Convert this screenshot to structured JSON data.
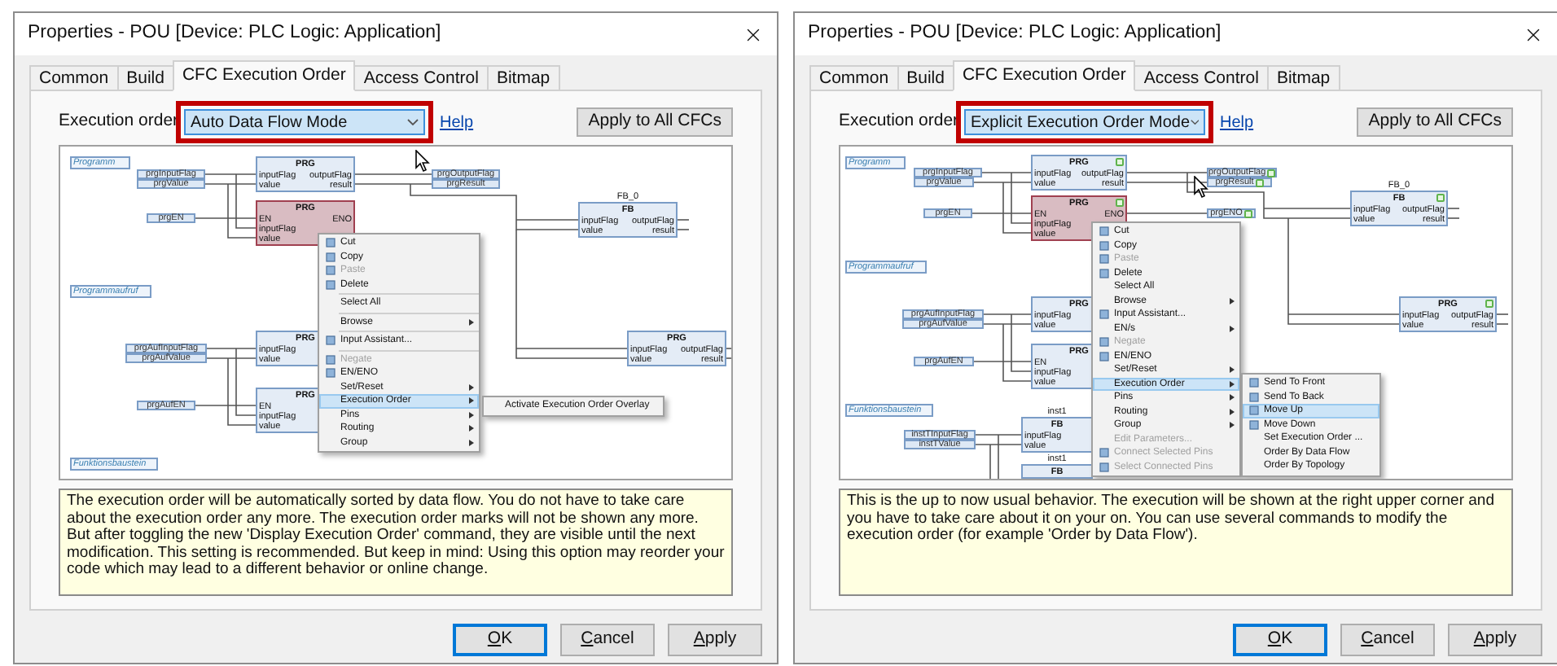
{
  "dialogs": [
    {
      "title": "Properties - POU [Device: PLC Logic: Application]",
      "tabs": [
        {
          "label": "Common",
          "selected": false
        },
        {
          "label": "Build",
          "selected": false
        },
        {
          "label": "CFC Execution Order",
          "selected": true
        },
        {
          "label": "Access Control",
          "selected": false
        },
        {
          "label": "Bitmap",
          "selected": false
        }
      ],
      "execution_order": {
        "label": "Execution order",
        "value": "Auto Data Flow Mode"
      },
      "help_link": "Help",
      "apply_all_button": "Apply to All CFCs",
      "diagram": {
        "comments": [
          "Programm",
          "Programmaufruf",
          "Funktionsbaustein"
        ],
        "variables": [
          {
            "name": "prgInputFlag",
            "order_badge": false
          },
          {
            "name": "prgOutputFlag",
            "order_badge": false
          },
          {
            "name": "prgValue",
            "order_badge": false
          },
          {
            "name": "prgResult",
            "order_badge": false
          },
          {
            "name": "prgEN",
            "order_badge": false
          },
          {
            "name": "prgAufInputFlag",
            "order_badge": false
          },
          {
            "name": "prgAufValue",
            "order_badge": false
          },
          {
            "name": "prgAufEN",
            "order_badge": false
          }
        ],
        "blocks": [
          {
            "type": "PRG",
            "inputs": [
              "inputFlag",
              "value"
            ],
            "outputs": [
              "outputFlag",
              "result"
            ],
            "selected": false,
            "order_badge": false
          },
          {
            "type": "PRG",
            "inputs": [
              "EN",
              "inputFlag",
              "value"
            ],
            "outputs": [
              "ENO"
            ],
            "selected": true,
            "order_badge": false
          },
          {
            "type": "FB",
            "instance": "FB_0",
            "inputs": [
              "inputFlag",
              "value"
            ],
            "outputs": [
              "outputFlag",
              "result"
            ],
            "selected": false,
            "order_badge": false
          },
          {
            "type": "PRG",
            "inputs": [
              "inputFlag",
              "value"
            ],
            "selected": false
          },
          {
            "type": "PRG",
            "inputs": [
              "inputFlag",
              "value"
            ],
            "outputs": [
              "outputFlag",
              "result"
            ],
            "selected": false,
            "order_badge": false
          },
          {
            "type": "PRG",
            "inputs": [
              "EN",
              "inputFlag",
              "value"
            ],
            "selected": false
          }
        ],
        "context_menu": [
          {
            "kind": "item",
            "label": "Cut",
            "has_icon": true,
            "disabled": false,
            "highlighted": false,
            "has_submenu": false
          },
          {
            "kind": "item",
            "label": "Copy",
            "has_icon": true,
            "disabled": false,
            "highlighted": false,
            "has_submenu": false
          },
          {
            "kind": "item",
            "label": "Paste",
            "has_icon": true,
            "disabled": true,
            "highlighted": false,
            "has_submenu": false
          },
          {
            "kind": "item",
            "label": "Delete",
            "has_icon": true,
            "disabled": false,
            "highlighted": false,
            "has_submenu": false
          },
          {
            "kind": "separator"
          },
          {
            "kind": "item",
            "label": "Select All",
            "has_icon": false,
            "disabled": false,
            "highlighted": false,
            "has_submenu": false
          },
          {
            "kind": "separator"
          },
          {
            "kind": "item",
            "label": "Browse",
            "has_icon": false,
            "disabled": false,
            "highlighted": false,
            "has_submenu": true
          },
          {
            "kind": "separator"
          },
          {
            "kind": "item",
            "label": "Input Assistant...",
            "has_icon": true,
            "disabled": false,
            "highlighted": false,
            "has_submenu": false
          },
          {
            "kind": "separator"
          },
          {
            "kind": "item",
            "label": "Negate",
            "has_icon": true,
            "disabled": true,
            "highlighted": false,
            "has_submenu": false
          },
          {
            "kind": "item",
            "label": "EN/ENO",
            "has_icon": true,
            "disabled": false,
            "highlighted": false,
            "has_submenu": false
          },
          {
            "kind": "item",
            "label": "Set/Reset",
            "has_icon": false,
            "disabled": false,
            "highlighted": false,
            "has_submenu": true
          },
          {
            "kind": "item",
            "label": "Execution Order",
            "has_icon": false,
            "disabled": false,
            "highlighted": true,
            "has_submenu": true
          },
          {
            "kind": "item",
            "label": "Pins",
            "has_icon": false,
            "disabled": false,
            "highlighted": false,
            "has_submenu": true
          },
          {
            "kind": "item",
            "label": "Routing",
            "has_icon": false,
            "disabled": false,
            "highlighted": false,
            "has_submenu": true
          },
          {
            "kind": "item",
            "label": "Group",
            "has_icon": false,
            "disabled": false,
            "highlighted": false,
            "has_submenu": true
          }
        ],
        "submenu": [
          {
            "label": "Activate Execution Order Overlay",
            "has_icon": false,
            "highlighted": false
          }
        ]
      },
      "description": "The execution order will be automatically sorted by data flow. You do not have to take care about the execution order any more. The execution order marks will not be shown any more. But after toggling the new 'Display Execution Order' command, they are visible until the next modification. This setting is recommended. But keep in mind: Using this option may reorder your code which may lead to a different behavior or online change.",
      "buttons": [
        {
          "label": "OK",
          "default": true
        },
        {
          "label": "Cancel",
          "default": false
        },
        {
          "label": "Apply",
          "default": false
        }
      ]
    },
    {
      "title": "Properties - POU [Device: PLC Logic: Application]",
      "tabs": [
        {
          "label": "Common",
          "selected": false
        },
        {
          "label": "Build",
          "selected": false
        },
        {
          "label": "CFC Execution Order",
          "selected": true
        },
        {
          "label": "Access Control",
          "selected": false
        },
        {
          "label": "Bitmap",
          "selected": false
        }
      ],
      "execution_order": {
        "label": "Execution order",
        "value": "Explicit Execution Order Mode"
      },
      "help_link": "Help",
      "apply_all_button": "Apply to All CFCs",
      "diagram": {
        "comments": [
          "Programm",
          "Programmaufruf",
          "Funktionsbaustein"
        ],
        "variables": [
          {
            "name": "prgInputFlag",
            "order_badge": false
          },
          {
            "name": "prgOutputFlag",
            "order_badge": true
          },
          {
            "name": "prgValue",
            "order_badge": false
          },
          {
            "name": "prgResult",
            "order_badge": true
          },
          {
            "name": "prgEN",
            "order_badge": false
          },
          {
            "name": "prgENO",
            "order_badge": true
          },
          {
            "name": "prgAufInputFlag",
            "order_badge": false
          },
          {
            "name": "prgAufValue",
            "order_badge": false
          },
          {
            "name": "prgAufEN",
            "order_badge": false
          },
          {
            "name": "instTInputFlag",
            "order_badge": false
          },
          {
            "name": "instTValue",
            "order_badge": false
          }
        ],
        "blocks": [
          {
            "type": "PRG",
            "inputs": [
              "inputFlag",
              "value"
            ],
            "outputs": [
              "outputFlag",
              "result"
            ],
            "selected": false,
            "order_badge": true
          },
          {
            "type": "PRG",
            "inputs": [
              "EN",
              "inputFlag",
              "value"
            ],
            "outputs": [
              "ENO"
            ],
            "selected": true,
            "order_badge": true
          },
          {
            "type": "FB",
            "instance": "FB_0",
            "inputs": [
              "inputFlag",
              "value"
            ],
            "outputs": [
              "outputFlag",
              "result"
            ],
            "selected": false,
            "order_badge": true
          },
          {
            "type": "PRG",
            "inputs": [
              "inputFlag",
              "value"
            ],
            "selected": false
          },
          {
            "type": "PRG",
            "inputs": [
              "inputFlag",
              "value"
            ],
            "outputs": [
              "outputFlag",
              "result"
            ],
            "selected": false,
            "order_badge": true
          },
          {
            "type": "PRG",
            "inputs": [
              "EN",
              "inputFlag",
              "value"
            ],
            "selected": false
          },
          {
            "type": "FB",
            "instance": "inst1",
            "inputs": [
              "inputFlag",
              "value"
            ],
            "selected": false,
            "order_badge": false
          },
          {
            "type": "FB",
            "instance": "inst1",
            "selected": false,
            "order_badge": false
          }
        ],
        "context_menu": [
          {
            "kind": "item",
            "label": "Cut",
            "has_icon": true,
            "disabled": false,
            "highlighted": false,
            "has_submenu": false
          },
          {
            "kind": "item",
            "label": "Copy",
            "has_icon": true,
            "disabled": false,
            "highlighted": false,
            "has_submenu": false
          },
          {
            "kind": "item",
            "label": "Paste",
            "has_icon": true,
            "disabled": true,
            "highlighted": false,
            "has_submenu": false
          },
          {
            "kind": "item",
            "label": "Delete",
            "has_icon": true,
            "disabled": false,
            "highlighted": false,
            "has_submenu": false
          },
          {
            "kind": "item",
            "label": "Select All",
            "has_icon": false,
            "disabled": false,
            "highlighted": false,
            "has_submenu": false
          },
          {
            "kind": "item",
            "label": "Browse",
            "has_icon": false,
            "disabled": false,
            "highlighted": false,
            "has_submenu": true
          },
          {
            "kind": "item",
            "label": "Input Assistant...",
            "has_icon": true,
            "disabled": false,
            "highlighted": false,
            "has_submenu": false
          },
          {
            "kind": "item",
            "label": "EN/s",
            "has_icon": false,
            "disabled": false,
            "highlighted": false,
            "has_submenu": true
          },
          {
            "kind": "item",
            "label": "Negate",
            "has_icon": true,
            "disabled": true,
            "highlighted": false,
            "has_submenu": false
          },
          {
            "kind": "item",
            "label": "EN/ENO",
            "has_icon": true,
            "disabled": false,
            "highlighted": false,
            "has_submenu": false
          },
          {
            "kind": "item",
            "label": "Set/Reset",
            "has_icon": false,
            "disabled": false,
            "highlighted": false,
            "has_submenu": true
          },
          {
            "kind": "item",
            "label": "Execution Order",
            "has_icon": false,
            "disabled": false,
            "highlighted": true,
            "has_submenu": true
          },
          {
            "kind": "item",
            "label": "Pins",
            "has_icon": false,
            "disabled": false,
            "highlighted": false,
            "has_submenu": true
          },
          {
            "kind": "item",
            "label": "Routing",
            "has_icon": false,
            "disabled": false,
            "highlighted": false,
            "has_submenu": true
          },
          {
            "kind": "item",
            "label": "Group",
            "has_icon": false,
            "disabled": false,
            "highlighted": false,
            "has_submenu": true
          },
          {
            "kind": "item",
            "label": "Edit Parameters...",
            "has_icon": false,
            "disabled": true,
            "highlighted": false,
            "has_submenu": false
          },
          {
            "kind": "item",
            "label": "Connect Selected Pins",
            "has_icon": true,
            "disabled": true,
            "highlighted": false,
            "has_submenu": false
          },
          {
            "kind": "item",
            "label": "Select Connected Pins",
            "has_icon": true,
            "disabled": true,
            "highlighted": false,
            "has_submenu": false
          }
        ],
        "submenu": [
          {
            "label": "Send To Front",
            "has_icon": true,
            "highlighted": false
          },
          {
            "label": "Send To Back",
            "has_icon": true,
            "highlighted": false
          },
          {
            "label": "Move Up",
            "has_icon": true,
            "highlighted": true
          },
          {
            "label": "Move Down",
            "has_icon": true,
            "highlighted": false
          },
          {
            "label": "Set Execution Order ...",
            "has_icon": false,
            "highlighted": false
          },
          {
            "label": "Order By Data Flow",
            "has_icon": false,
            "highlighted": false
          },
          {
            "label": "Order By Topology",
            "has_icon": false,
            "highlighted": false
          }
        ]
      },
      "description": "This is the up to now usual behavior. The execution will be shown at the right upper corner and you have to take care about it on your on. You can use several commands to modify the execution order (for example 'Order by Data Flow').",
      "buttons": [
        {
          "label": "OK",
          "default": true
        },
        {
          "label": "Cancel",
          "default": false
        },
        {
          "label": "Apply",
          "default": false
        }
      ]
    }
  ]
}
